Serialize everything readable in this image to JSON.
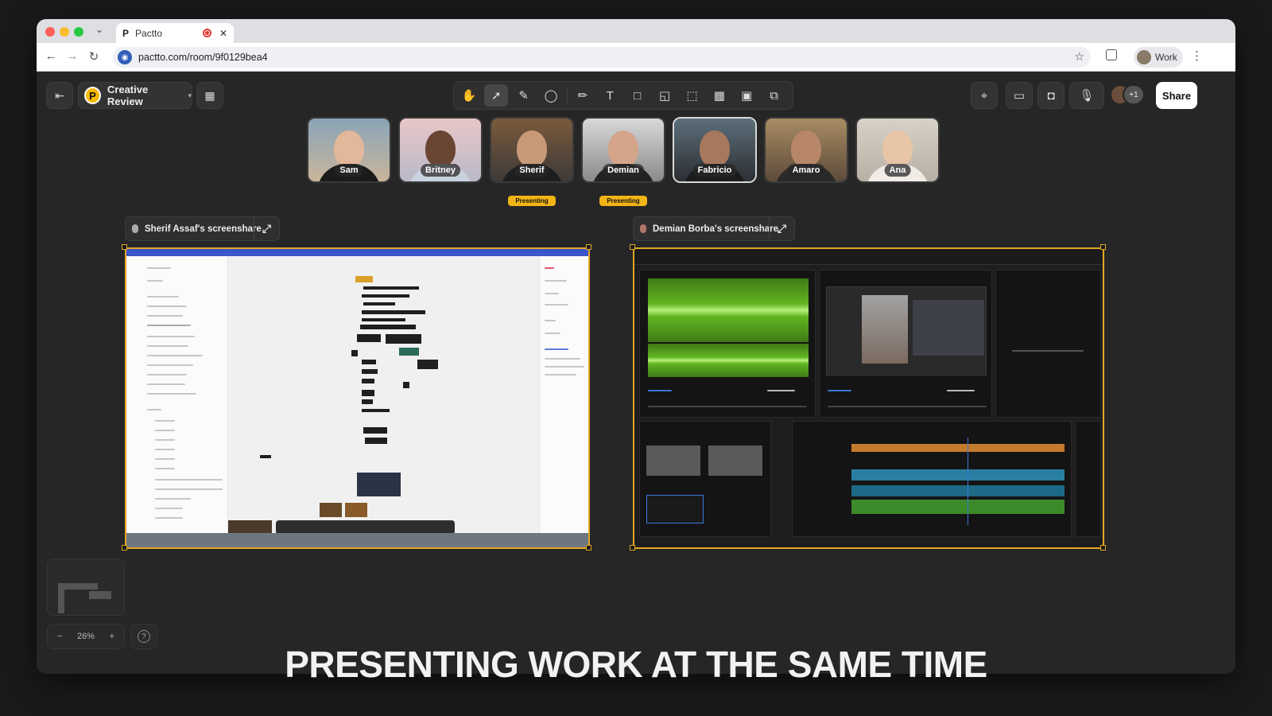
{
  "browser": {
    "tab_title": "Pactto",
    "tab_favicon": "P",
    "url": "pactto.com/room/9f0129bea4",
    "profile_label": "Work"
  },
  "room": {
    "logo_letter": "P",
    "name": "Creative Review"
  },
  "toolbar": {
    "tools": [
      "hand-icon",
      "pointer-icon",
      "pen-icon",
      "lasso-icon",
      "pencil-icon",
      "text-icon",
      "shape-icon",
      "note-icon",
      "upload-icon",
      "table-icon",
      "embed-icon",
      "image-icon"
    ]
  },
  "header_right": {
    "avatar_more": "+1",
    "share_label": "Share"
  },
  "participants": [
    {
      "name": "Sam",
      "presenting": false
    },
    {
      "name": "Britney",
      "presenting": false
    },
    {
      "name": "Sherif",
      "presenting": true
    },
    {
      "name": "Demian",
      "presenting": true
    },
    {
      "name": "Fabricio",
      "presenting": false
    },
    {
      "name": "Amaro",
      "presenting": false
    },
    {
      "name": "Ana",
      "presenting": false
    }
  ],
  "presenting_label": "Presenting",
  "screenshares": [
    {
      "title": "Sherif Assaf's screenshare"
    },
    {
      "title": "Demian Borba's screenshare"
    }
  ],
  "canvas": {
    "zoom_minus": "−",
    "zoom_level": "26%",
    "zoom_plus": "+",
    "help": "?"
  },
  "caption": "PRESENTING WORK AT THE SAME TIME",
  "colors": {
    "accent": "#e2a722",
    "presenting_badge": "#f2b416",
    "background": "#262626"
  }
}
